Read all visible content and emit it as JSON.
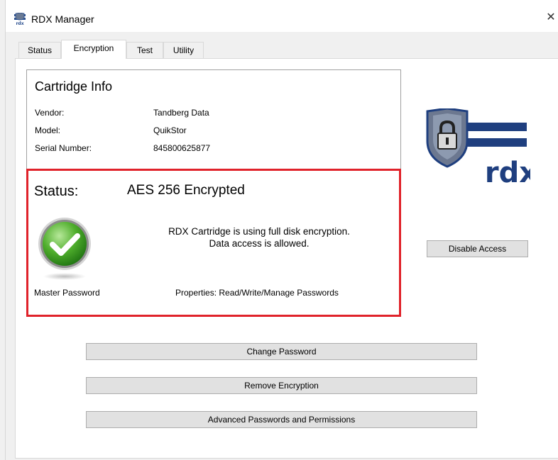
{
  "window": {
    "title": "RDX Manager",
    "close_glyph": "✕",
    "app_icon": "rdx-app-icon"
  },
  "tabs": [
    {
      "label": "Status",
      "active": false
    },
    {
      "label": "Encryption",
      "active": true
    },
    {
      "label": "Test",
      "active": false
    },
    {
      "label": "Utility",
      "active": false
    }
  ],
  "cartridge": {
    "title": "Cartridge Info",
    "vendor_label": "Vendor:",
    "vendor": "Tandberg Data",
    "model_label": "Model:",
    "model": "QuikStor",
    "serial_label": "Serial Number:",
    "serial": "845800625877"
  },
  "status": {
    "label": "Status:",
    "value": "AES 256 Encrypted",
    "message_line1": "RDX Cartridge is using full disk encryption.",
    "message_line2": "Data access is allowed.",
    "master_password": "Master Password",
    "properties": "Properties: Read/Write/Manage Passwords",
    "highlight_color": "#e0222a",
    "icon": "green-check-icon"
  },
  "logo": {
    "text": "rdx",
    "icon": "shield-padlock-icon",
    "color": "#1f3f7f"
  },
  "buttons": {
    "disable_access": "Disable Access",
    "change_password": "Change Password",
    "remove_encryption": "Remove Encryption",
    "advanced": "Advanced Passwords and Permissions"
  }
}
